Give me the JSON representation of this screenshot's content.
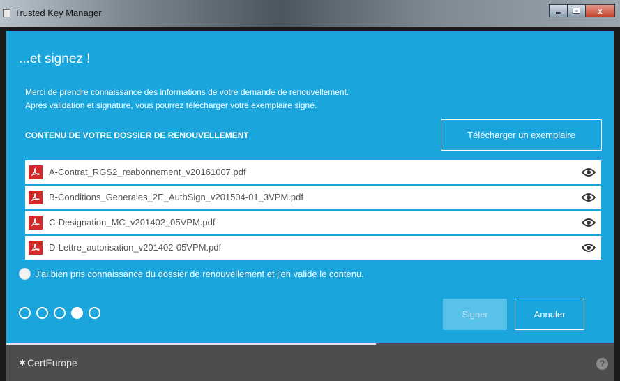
{
  "window": {
    "title": "Trusted Key Manager",
    "close_glyph": "x"
  },
  "main": {
    "heading": "...et signez !",
    "intro_line1": "Merci de prendre connaissance des informations de votre demande de renouvellement.",
    "intro_line2": "Après validation et signature, vous pourrez télécharger votre exemplaire signé.",
    "section_title": "CONTENU DE VOTRE DOSSIER DE RENOUVELLEMENT",
    "download_label": "Télécharger un exemplaire",
    "files": [
      {
        "name": "A-Contrat_RGS2_reabonnement_v20161007.pdf",
        "icon": "pdf-icon"
      },
      {
        "name": "B-Conditions_Generales_2E_AuthSign_v201504-01_3VPM.pdf",
        "icon": "pdf-icon"
      },
      {
        "name": "C-Designation_MC_v201402_05VPM.pdf",
        "icon": "pdf-icon"
      },
      {
        "name": "D-Lettre_autorisation_v201402-05VPM.pdf",
        "icon": "pdf-icon"
      }
    ],
    "consent_text": "J'ai bien pris connaissance du dossier de renouvellement et j'en valide le contenu.",
    "consent_checked": false,
    "steps": {
      "total": 5,
      "current": 4
    },
    "sign_label": "Signer",
    "cancel_label": "Annuler"
  },
  "footer": {
    "brand": "CertEurope",
    "help_glyph": "?"
  },
  "colors": {
    "panel": "#1aa5dd",
    "pdf_icon": "#d22a2a",
    "footer": "#4d4d4d"
  }
}
